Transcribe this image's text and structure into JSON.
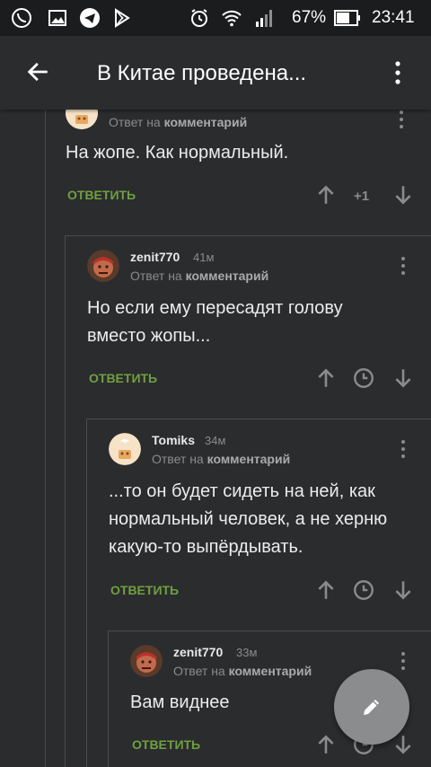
{
  "statusbar": {
    "battery": "67%",
    "time": "23:41"
  },
  "header": {
    "title": "В Китае проведена..."
  },
  "comments": [
    {
      "reply_prefix": "Ответ на",
      "reply_target": "комментарий",
      "text": "На жопе. Как нормальный.",
      "reply_label": "ОТВЕТИТЬ",
      "rating": "+1"
    },
    {
      "author": "zenit770",
      "time": "41м",
      "reply_prefix": "Ответ на",
      "reply_target": "комментарий",
      "text_lines": [
        "Но если ему пересадят голову",
        "вместо жопы..."
      ],
      "reply_label": "ОТВЕТИТЬ"
    },
    {
      "author": "Tomiks",
      "time": "34м",
      "reply_prefix": "Ответ на",
      "reply_target": "комментарий",
      "text_lines": [
        "...то он будет сидеть на ней, как",
        "нормальный человек, а не херню",
        "какую-то выпёрдывать."
      ],
      "reply_label": "ОТВЕТИТЬ"
    },
    {
      "author": "zenit770",
      "time": "33м",
      "reply_prefix": "Ответ на",
      "reply_target": "комментарий",
      "text": "Вам виднее",
      "reply_label": "ОТВЕТИТЬ"
    }
  ],
  "icons": {
    "back": "arrow-back-icon",
    "menu": "more-vertical-icon",
    "upvote": "arrow-up-icon",
    "downvote": "arrow-down-icon",
    "pending": "clock-icon",
    "fab": "pencil-icon"
  },
  "colors": {
    "background": "#2b2c2e",
    "statusbar": "#1b1c1d",
    "reply_accent": "#6fa03f",
    "fab": "#8b8c8e"
  }
}
